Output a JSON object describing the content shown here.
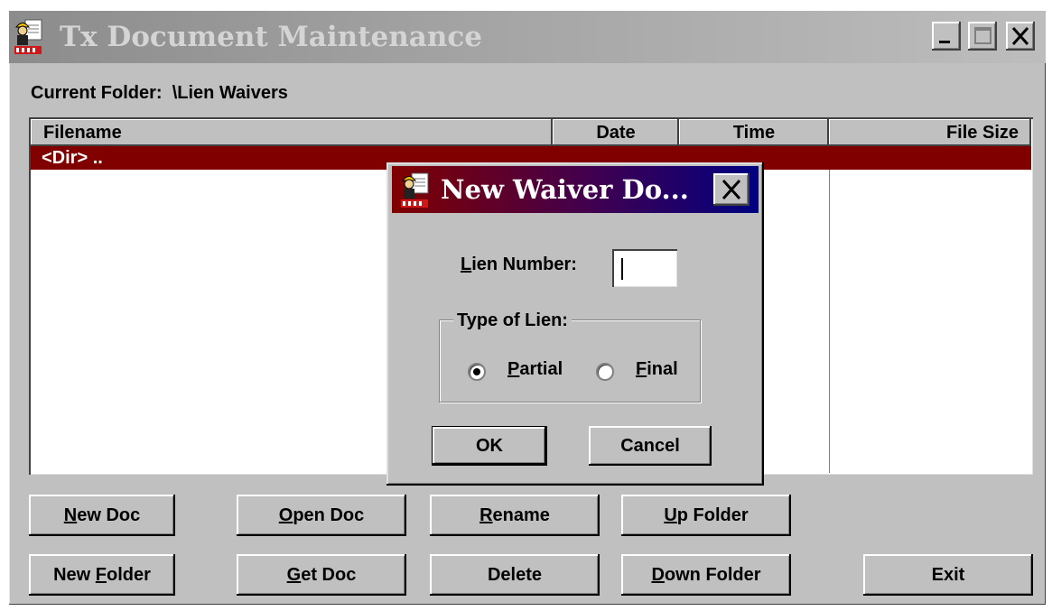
{
  "window": {
    "title": "Tx Document Maintenance",
    "current_folder_label": "Current Folder:",
    "current_folder_path": "\\Lien Waivers"
  },
  "list": {
    "columns": [
      "Filename",
      "Date",
      "Time",
      "File Size"
    ],
    "rows": [
      {
        "filename": "<Dir> ..",
        "date": "",
        "time": "",
        "size": "",
        "selected": true
      }
    ]
  },
  "buttons": {
    "new_doc": {
      "pre": "",
      "key": "N",
      "post": "ew Doc"
    },
    "open_doc": {
      "pre": "",
      "key": "O",
      "post": "pen Doc"
    },
    "rename": {
      "pre": "",
      "key": "R",
      "post": "ename"
    },
    "up_folder": {
      "pre": "",
      "key": "U",
      "post": "p Folder"
    },
    "new_folder": {
      "pre": "New ",
      "key": "F",
      "post": "older"
    },
    "get_doc": {
      "pre": "",
      "key": "G",
      "post": "et Doc"
    },
    "delete": {
      "pre": "Delete",
      "key": "",
      "post": ""
    },
    "down_folder": {
      "pre": "",
      "key": "D",
      "post": "own Folder"
    },
    "exit": {
      "pre": "Exit",
      "key": "",
      "post": ""
    }
  },
  "dialog": {
    "title": "New Waiver Do...",
    "lien_number_label_key": "L",
    "lien_number_label_rest": "ien Number:",
    "lien_number_value": "",
    "type_group_label": "Type of Lien:",
    "options": [
      {
        "key": "P",
        "rest": "artial",
        "checked": true
      },
      {
        "key": "F",
        "rest": "inal",
        "checked": false
      }
    ],
    "ok_label": "OK",
    "cancel_label": "Cancel"
  },
  "colors": {
    "selection": "#800000",
    "dialog_title_start": "#800000",
    "dialog_title_end": "#000080",
    "face": "#c0c0c0"
  }
}
